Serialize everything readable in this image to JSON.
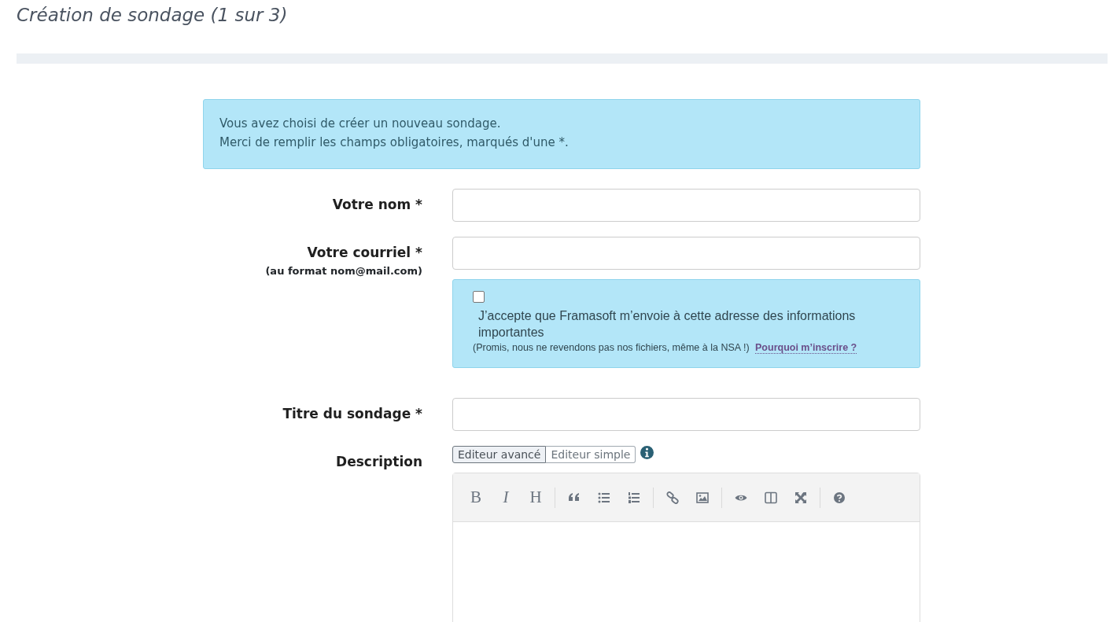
{
  "page_title": "Création de sondage (1 sur 3)",
  "intro_alert": [
    "Vous avez choisi de créer un nouveau sondage.",
    "Merci de remplir les champs obligatoires, marqués d'une *."
  ],
  "name_field": {
    "label": "Votre nom *"
  },
  "email_field": {
    "label": "Votre courriel *",
    "hint": "(au format nom@mail.com)"
  },
  "newsletter": {
    "checked": false,
    "label": "J’accepte que Framasoft m’envoie à cette adresse des informations importantes",
    "note": "(Promis, nous ne revendons pas nos fichiers, même à la NSA !)",
    "link": "Pourquoi m’inscrire ?"
  },
  "title_field": {
    "label": "Titre du sondage *"
  },
  "description": {
    "label": "Description",
    "editor_tabs": [
      {
        "label": "Editeur avancé",
        "selected": true
      },
      {
        "label": "Editeur simple",
        "selected": false
      }
    ],
    "toolbar": [
      {
        "kind": "text",
        "label": "B"
      },
      {
        "kind": "text",
        "label": "I"
      },
      {
        "kind": "text",
        "label": "H"
      },
      {
        "kind": "separator"
      },
      {
        "kind": "quote"
      },
      {
        "kind": "bullet-list"
      },
      {
        "kind": "numbered-list"
      },
      {
        "kind": "separator"
      },
      {
        "kind": "link"
      },
      {
        "kind": "image"
      },
      {
        "kind": "separator"
      },
      {
        "kind": "preview"
      },
      {
        "kind": "side-by-side"
      },
      {
        "kind": "fullscreen"
      },
      {
        "kind": "separator"
      },
      {
        "kind": "help"
      }
    ]
  }
}
